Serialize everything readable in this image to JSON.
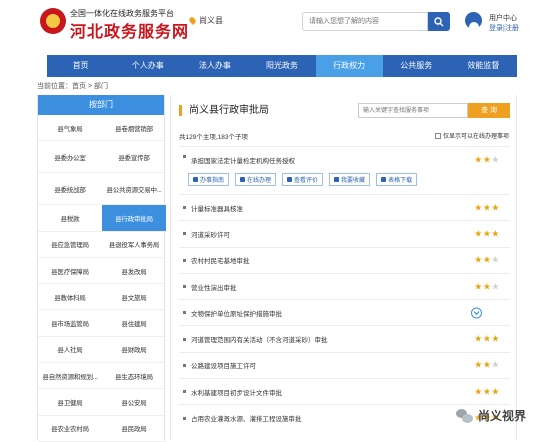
{
  "header": {
    "subtitle": "全国一体化在线政务服务平台",
    "title": "河北政务服务网",
    "location": "尚义县",
    "search_placeholder": "请输入您想了解的内容",
    "user_center": "用户中心",
    "login": "登录",
    "separator": "|",
    "register": "注册"
  },
  "nav": [
    "首页",
    "个人办事",
    "法人办事",
    "阳光政务",
    "行政权力",
    "公共服务",
    "效能监督"
  ],
  "nav_active": "行政权力",
  "breadcrumb": "当前位置：首页 > 部门",
  "sidebar": {
    "header": "按部门",
    "items": [
      "县气象局",
      "县卷烟营销部",
      "县委办公室",
      "县委宣传部",
      "县委统战部",
      "县公共资源交易中...",
      "县税款",
      "县行政审批局",
      "县应急管理局",
      "县退役军人事务局",
      "县医疗保障局",
      "县发改局",
      "县教体科局",
      "县文旅局",
      "县市场监管局",
      "县住建局",
      "县人社局",
      "县财政局",
      "县自然资源和规划...",
      "县生态环境局",
      "县卫健局",
      "县公安局",
      "县农业农村局",
      "县民政局"
    ],
    "active": "县行政审批局"
  },
  "main": {
    "title": "尚义县行政审批局",
    "search_placeholder": "输入关键字查找服务事项",
    "search_button": "查 询",
    "count_text": "共129个主项,183个子项",
    "only_online_label": "仅显示可以在线办理事项",
    "actions": [
      "办事指南",
      "在线办理",
      "查看评价",
      "我要收藏",
      "表格下载"
    ],
    "items": [
      {
        "title": "承担国家法定计量检定机构任务授权",
        "stars": 2
      },
      {
        "title": "计量标准器具核准",
        "stars": 3
      },
      {
        "title": "河道采砂许可",
        "stars": 3
      },
      {
        "title": "农村村民宅基地审批",
        "stars": 2
      },
      {
        "title": "营业性演出审批",
        "stars": 2
      },
      {
        "title": "文物保护单位原址保护措施审批",
        "stars": 0
      },
      {
        "title": "河道管理范围内有关活动（不含河道采砂）审批",
        "stars": 3
      },
      {
        "title": "公路建设项目施工许可",
        "stars": 2
      },
      {
        "title": "水利基建项目初步设计文件审批",
        "stars": 3
      },
      {
        "title": "占用农业灌溉水源、灌排工程设施审批",
        "stars": 3
      }
    ]
  },
  "watermark": "尚义视界",
  "colors": {
    "nav_blue": "#2c63b4",
    "active_blue": "#3d8fe0",
    "accent_orange": "#f0a020",
    "brand_red": "#c8161d"
  }
}
